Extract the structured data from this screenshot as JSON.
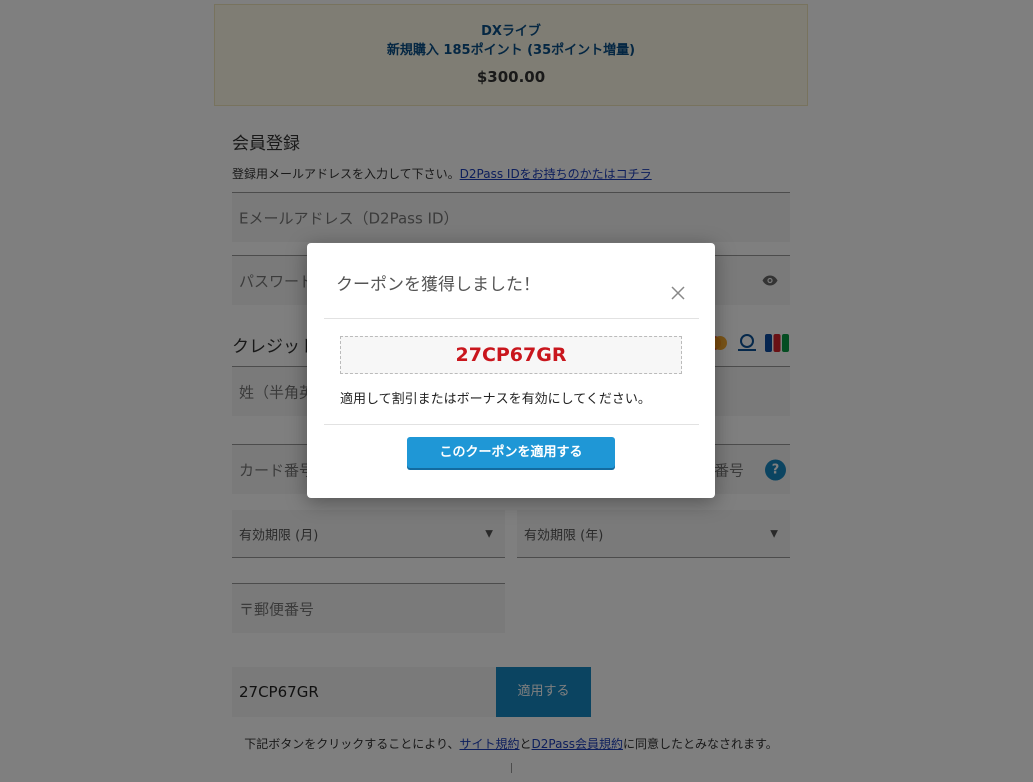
{
  "product": {
    "name": "DXライブ",
    "subtitle": "新規購入 185ポイント (35ポイント増量)",
    "price": "$300.00"
  },
  "registration": {
    "heading": "会員登録",
    "note": "登録用メールアドレスを入力して下さい。",
    "note_link": "D2Pass IDをお持ちのかたはコチラ",
    "email_placeholder": "Eメールアドレス（D2Pass ID）",
    "password_placeholder": "パスワード"
  },
  "credit": {
    "heading": "クレジット",
    "lastname_placeholder": "姓（半角英",
    "card_number_placeholder": "カード番号",
    "security_code_placeholder": "番号",
    "help_icon_text": "?",
    "exp_month_placeholder": "有効期限 (月)",
    "exp_year_placeholder": "有効期限 (年)",
    "postal_placeholder": "〒郵便番号",
    "card_icons": [
      "mastercard-icon",
      "diners-icon",
      "jcb-icon"
    ]
  },
  "coupon_field": {
    "value": "27CP67GR",
    "apply_label": "適用する"
  },
  "terms": {
    "prefix": "下記ボタンをクリックすることにより、",
    "site_terms": "サイト規約",
    "and": "と",
    "d2pass_terms": "D2Pass会員規約",
    "suffix": "に同意したとみなされます。"
  },
  "modal": {
    "title": "クーポンを獲得しました！",
    "coupon_code": "27CP67GR",
    "description": "適用して割引またはボーナスを有効にしてください。",
    "apply_button": "このクーポンを適用する"
  },
  "colors": {
    "accent": "#1f97d6",
    "coupon_text": "#c9161d",
    "product_bg": "#fffbe9",
    "link": "#1a3db8"
  }
}
